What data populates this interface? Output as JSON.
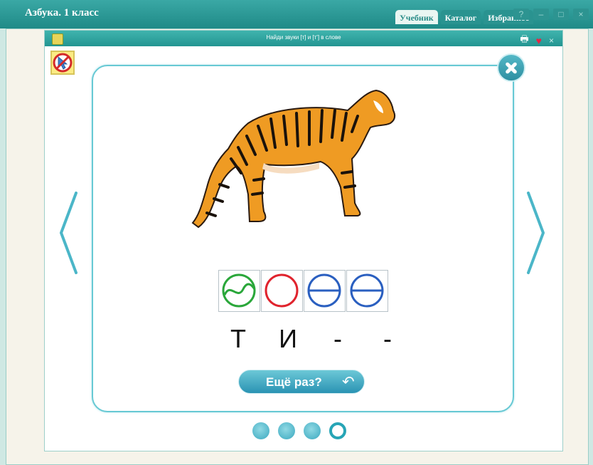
{
  "app": {
    "title": "Азбука. 1 класс",
    "tabs": [
      {
        "label": "Учебник",
        "active": true
      },
      {
        "label": "Каталог",
        "active": false
      },
      {
        "label": "Избранное",
        "active": false
      }
    ],
    "window_controls": [
      "?",
      "–",
      "□",
      "×"
    ]
  },
  "document": {
    "title": "Найди звуки [т] и [т'] в слове",
    "close_glyph": "×",
    "print_glyph": "🖶",
    "heart_glyph": "♥"
  },
  "exercise": {
    "sound_boxes": [
      {
        "type": "soft-consonant",
        "color": "#2aa73a"
      },
      {
        "type": "vowel",
        "color": "#e0232d"
      },
      {
        "type": "hard-consonant",
        "color": "#2a5fc0"
      },
      {
        "type": "hard-consonant",
        "color": "#2a5fc0"
      }
    ],
    "word_letters": [
      "Т",
      "И",
      "-",
      "-"
    ],
    "retry_button": "Ещё раз?",
    "retry_icon": "↶",
    "progress_dots": [
      "filled",
      "filled",
      "filled",
      "empty"
    ]
  },
  "icons": {
    "doc": "book-icon",
    "no_cursor": "no-cursor-icon",
    "close": "close-icon",
    "prev": "chevron-left-icon",
    "next": "chevron-right-icon",
    "tiger": "tiger-image"
  }
}
